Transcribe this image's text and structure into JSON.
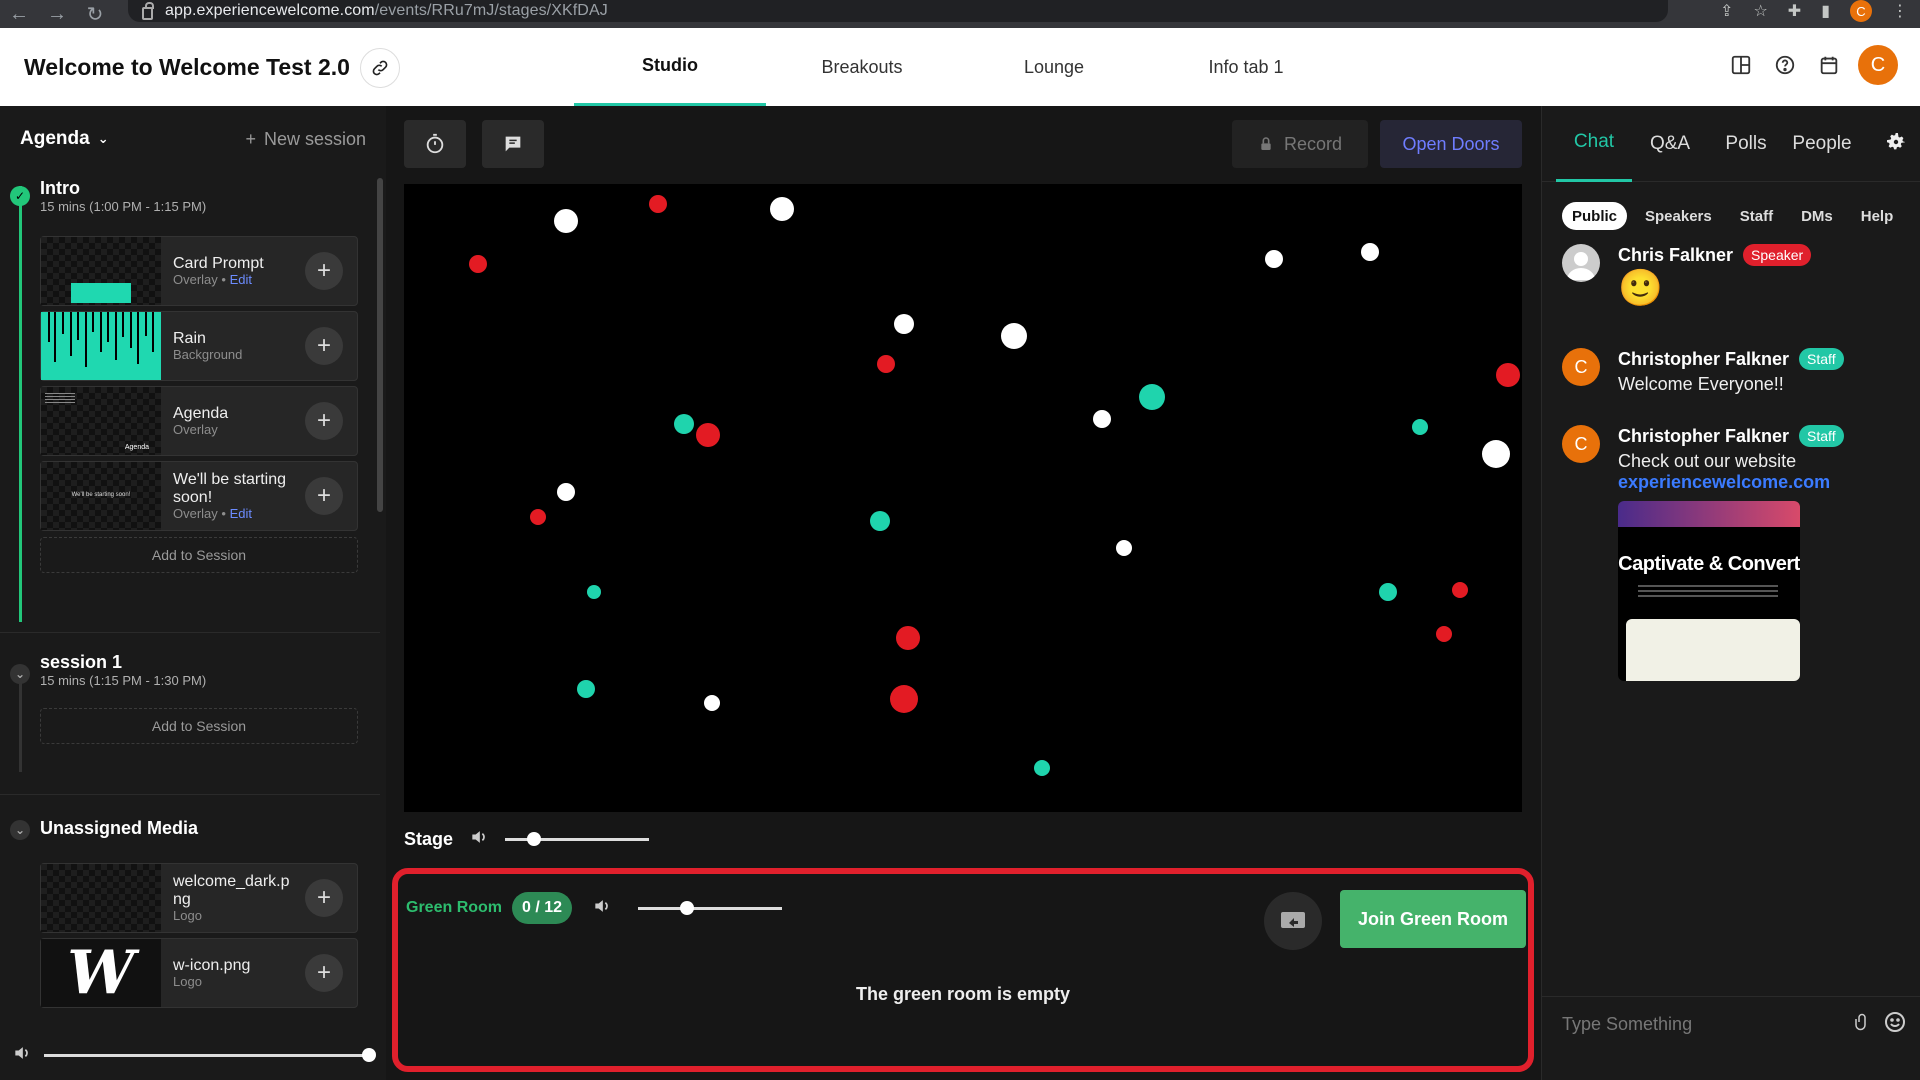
{
  "browser": {
    "url_host": "app.experiencewelcome.com",
    "url_path": "/events/RRu7mJ/stages/XKfDAJ",
    "avatar_letter": "C"
  },
  "header": {
    "event_title": "Welcome to Welcome Test 2.0",
    "tabs": [
      "Studio",
      "Breakouts",
      "Lounge",
      "Info tab 1"
    ],
    "active_tab": "Studio",
    "avatar_letter": "C"
  },
  "sidebar": {
    "agenda_label": "Agenda",
    "new_session_label": "New session",
    "sessions": [
      {
        "name": "Intro",
        "time": "15 mins (1:00 PM - 1:15 PM)",
        "media": [
          {
            "name": "Card Prompt",
            "type": "Overlay",
            "edit": "Edit"
          },
          {
            "name": "Rain",
            "type": "Background",
            "edit": ""
          },
          {
            "name": "Agenda",
            "type": "Overlay",
            "edit": ""
          },
          {
            "name": "We'll be starting soon!",
            "type": "Overlay",
            "edit": "Edit"
          }
        ],
        "add_label": "Add to Session"
      },
      {
        "name": "session 1",
        "time": "15 mins (1:15 PM - 1:30 PM)",
        "add_label": "Add to Session"
      }
    ],
    "unassigned": {
      "title": "Unassigned Media",
      "media": [
        {
          "name": "welcome_dark.png",
          "type": "Logo"
        },
        {
          "name": "w-icon.png",
          "type": "Logo"
        }
      ]
    },
    "thumb_texts": {
      "agenda": "Agenda",
      "starting": "We'll be starting soon!"
    },
    "volume": 1.0
  },
  "center": {
    "record_label": "Record",
    "open_doors_label": "Open Doors",
    "stage_label": "Stage",
    "stage_volume": 0.2,
    "green_room": {
      "label": "Green Room",
      "count": "0 / 12",
      "volume": 0.35,
      "join_label": "Join Green Room",
      "empty_text": "The green room is empty"
    }
  },
  "right_panel": {
    "tabs": [
      "Chat",
      "Q&A",
      "Polls",
      "People"
    ],
    "active_tab": "Chat",
    "sub_tabs": [
      "Public",
      "Speakers",
      "Staff",
      "DMs",
      "Help"
    ],
    "active_sub_tab": "Public",
    "messages": [
      {
        "author": "Chris Falkner",
        "badge": "Speaker",
        "emoji": "🙂"
      },
      {
        "author": "Christopher Falkner",
        "badge": "Staff",
        "avatar_letter": "C",
        "text": "Welcome Everyone!!"
      },
      {
        "author": "Christopher Falkner",
        "badge": "Staff",
        "avatar_letter": "C",
        "text": "Check out our website",
        "link": "experiencewelcome.com",
        "preview_title": "Captivate & Convert"
      }
    ],
    "input_placeholder": "Type Something"
  },
  "colors": {
    "accent": "#22c7a6",
    "record_red": "#e0202c",
    "green_room": "#45b36b",
    "link_blue": "#3b7bff",
    "open_doors": "#6f7dff"
  }
}
